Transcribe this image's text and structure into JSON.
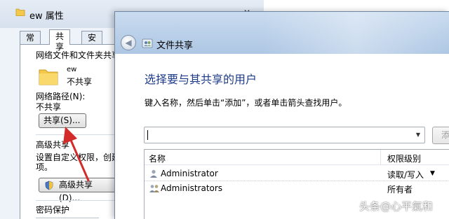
{
  "properties": {
    "title": "ew 属性",
    "tabs": [
      {
        "label": "常规"
      },
      {
        "label": "共享"
      },
      {
        "label": "安全"
      }
    ],
    "section_network": "网络文件和文件夹共享",
    "folder_name": "ew",
    "folder_status": "不共享",
    "network_path_label": "网络路径(N):",
    "network_path_value": "不共享",
    "share_button": "共享(S)...",
    "section_advanced": "高级共享",
    "advanced_desc_line1": "设置自定义权限，创建",
    "advanced_desc_line2": "项。",
    "advanced_button": "高级共享(D)...",
    "section_password": "密码保护"
  },
  "file_sharing": {
    "title": "文件共享",
    "heading": "选择要与其共享的用户",
    "instruction": "键入名称，然后单击“添加”，或者单击箭头查找用户。",
    "input_value": "",
    "add_button": "添",
    "columns": {
      "name": "名称",
      "permission": "权限级别"
    },
    "rows": [
      {
        "name": "Administrator",
        "permission": "读取/写入",
        "icon": "user-icon",
        "has_dropdown": true
      },
      {
        "name": "Administrators",
        "permission": "所有者",
        "icon": "group-icon",
        "has_dropdown": false
      }
    ]
  },
  "watermark": "头条@心平氣和",
  "colors": {
    "accent_red": "#d32a2a",
    "heading_blue": "#1e3b8a",
    "folder_yellow": "#f4c94b"
  }
}
